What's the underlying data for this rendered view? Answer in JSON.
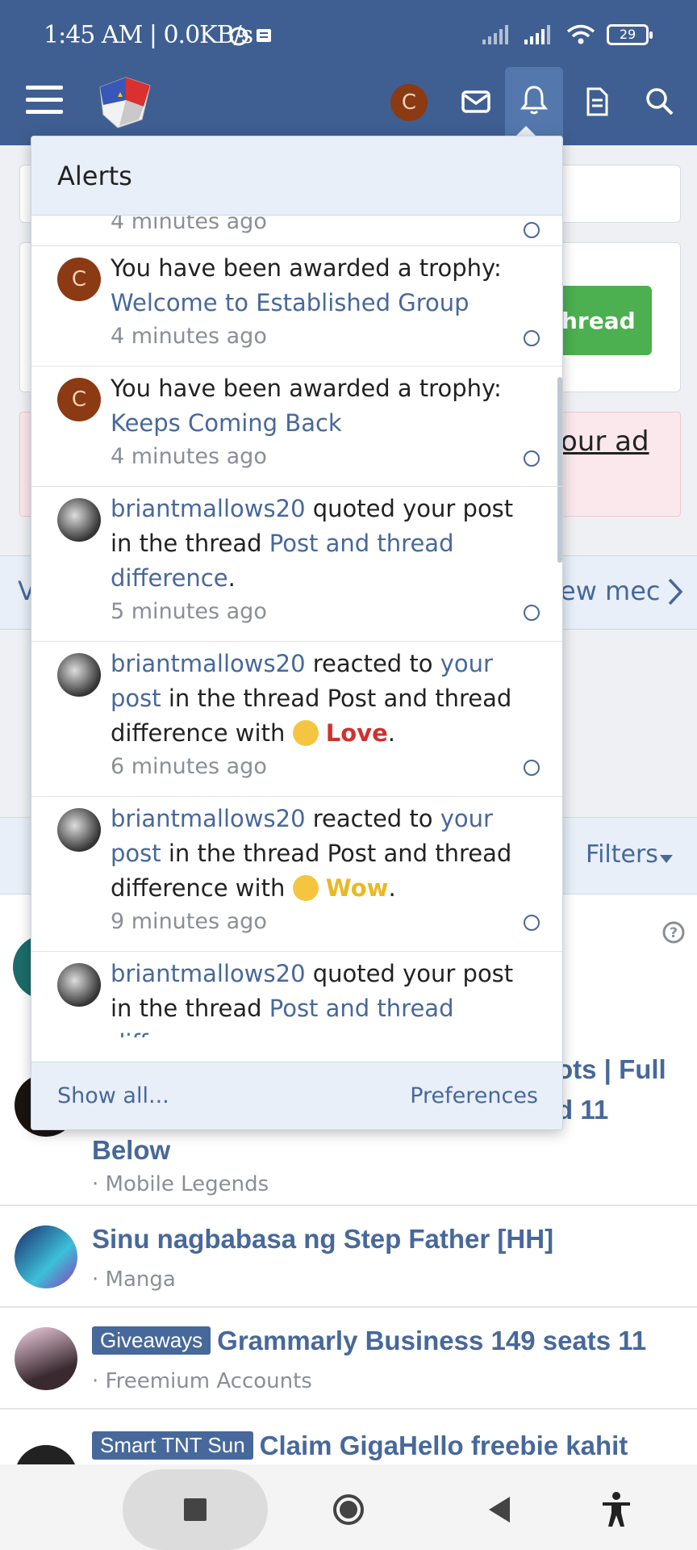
{
  "status_bar": {
    "time": "1:45 AM | 0.0KB/s",
    "battery": "29"
  },
  "header": {
    "user_initial": "C"
  },
  "background": {
    "green_button_label": "hread",
    "pink_link_label": "our ad",
    "strip_left": "V",
    "strip_right": "ew mec",
    "filters_label": "Filters",
    "rows": [
      {
        "title_partial": "ots | Full",
        "title_line2": "d 11",
        "title_line3": "Below",
        "subforum": "· Mobile Legends"
      },
      {
        "title": "Sinu nagbabasa ng Step Father [HH]",
        "subforum": "· Manga"
      },
      {
        "prefix": "Giveaways",
        "title": "Grammarly Business 149 seats 11",
        "subforum": "· Freemium Accounts"
      },
      {
        "prefix": "Smart TNT Sun",
        "title": "Claim GigaHello freebie kahit"
      }
    ]
  },
  "alerts": {
    "title": "Alerts",
    "items": [
      {
        "time": "4 minutes ago"
      },
      {
        "avatar": "C",
        "text": "You have been awarded a trophy:",
        "link": "Welcome to Established Group",
        "time": "4 minutes ago"
      },
      {
        "avatar": "C",
        "text": "You have been awarded a trophy:",
        "link": "Keeps Coming Back",
        "time": "4 minutes ago"
      },
      {
        "user": "briantmallows20",
        "text1": " quoted your post in the thread ",
        "link": "Post and thread difference",
        "text2": ".",
        "time": "5 minutes ago"
      },
      {
        "user": "briantmallows20",
        "text1": " reacted to ",
        "link": "your post",
        "text2": " in the thread Post and thread difference with ",
        "reaction": "Love",
        "text3": ".",
        "time": "6 minutes ago"
      },
      {
        "user": "briantmallows20",
        "text1": " reacted to ",
        "link": "your post",
        "text2": " in the thread Post and thread difference with ",
        "reaction": "Wow",
        "text3": ".",
        "time": "9 minutes ago"
      },
      {
        "user": "briantmallows20",
        "text1": " quoted your post in the thread ",
        "link": "Post and thread difference",
        "text2": "."
      }
    ],
    "show_all": "Show all...",
    "preferences": "Preferences"
  },
  "colors": {
    "header": "#3f5f92",
    "link": "#47689a",
    "green": "#4caf50",
    "love": "#d0312d",
    "wow": "#e9b923"
  }
}
